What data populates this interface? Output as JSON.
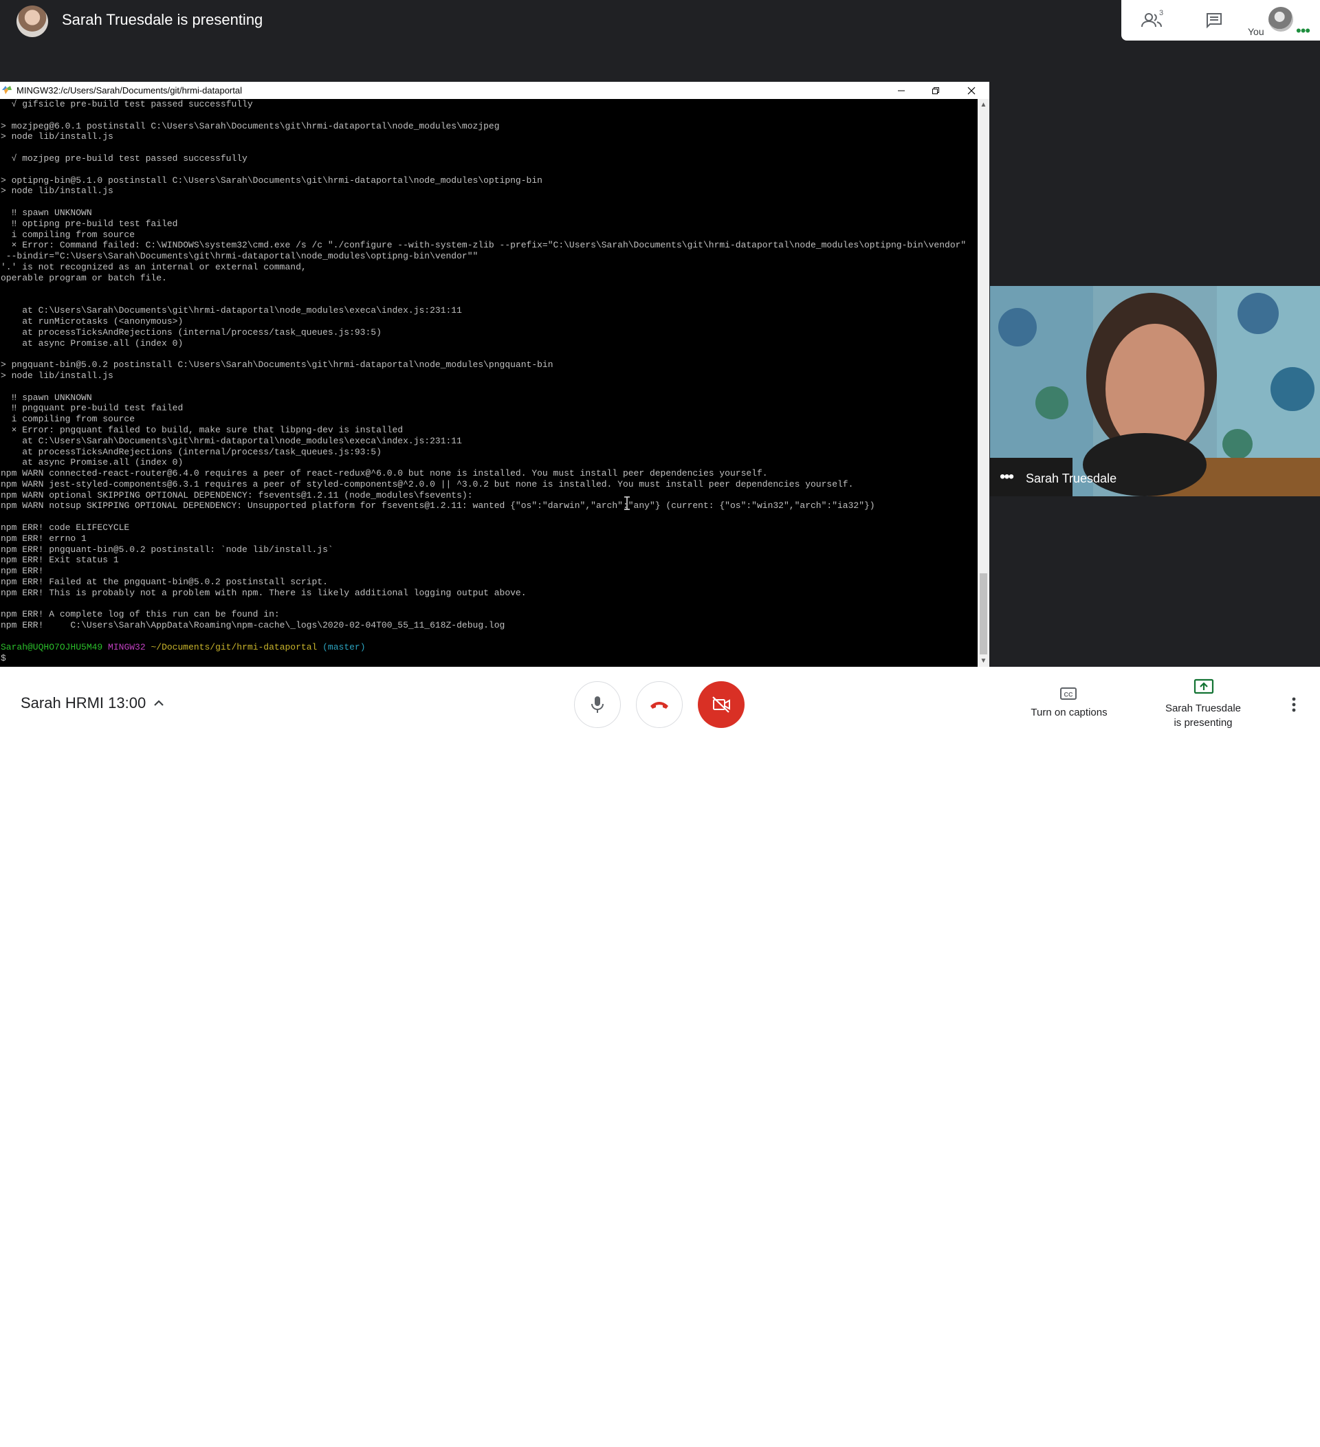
{
  "header": {
    "presenter_title": "Sarah Truesdale is presenting",
    "people_count": "3",
    "you_label": "You"
  },
  "terminal": {
    "window_title": "MINGW32:/c/Users/Sarah/Documents/git/hrmi-dataportal",
    "lines": [
      "  √ gifsicle pre-build test passed successfully",
      "",
      "> mozjpeg@6.0.1 postinstall C:\\Users\\Sarah\\Documents\\git\\hrmi-dataportal\\node_modules\\mozjpeg",
      "> node lib/install.js",
      "",
      "  √ mozjpeg pre-build test passed successfully",
      "",
      "> optipng-bin@5.1.0 postinstall C:\\Users\\Sarah\\Documents\\git\\hrmi-dataportal\\node_modules\\optipng-bin",
      "> node lib/install.js",
      "",
      "  ‼ spawn UNKNOWN",
      "  ‼ optipng pre-build test failed",
      "  i compiling from source",
      "  × Error: Command failed: C:\\WINDOWS\\system32\\cmd.exe /s /c \"./configure --with-system-zlib --prefix=\"C:\\Users\\Sarah\\Documents\\git\\hrmi-dataportal\\node_modules\\optipng-bin\\vendor\"",
      " --bindir=\"C:\\Users\\Sarah\\Documents\\git\\hrmi-dataportal\\node_modules\\optipng-bin\\vendor\"\"",
      "'.' is not recognized as an internal or external command,",
      "operable program or batch file.",
      "",
      "",
      "    at C:\\Users\\Sarah\\Documents\\git\\hrmi-dataportal\\node_modules\\execa\\index.js:231:11",
      "    at runMicrotasks (<anonymous>)",
      "    at processTicksAndRejections (internal/process/task_queues.js:93:5)",
      "    at async Promise.all (index 0)",
      "",
      "> pngquant-bin@5.0.2 postinstall C:\\Users\\Sarah\\Documents\\git\\hrmi-dataportal\\node_modules\\pngquant-bin",
      "> node lib/install.js",
      "",
      "  ‼ spawn UNKNOWN",
      "  ‼ pngquant pre-build test failed",
      "  i compiling from source",
      "  × Error: pngquant failed to build, make sure that libpng-dev is installed",
      "    at C:\\Users\\Sarah\\Documents\\git\\hrmi-dataportal\\node_modules\\execa\\index.js:231:11",
      "    at processTicksAndRejections (internal/process/task_queues.js:93:5)",
      "    at async Promise.all (index 0)",
      "npm WARN connected-react-router@6.4.0 requires a peer of react-redux@^6.0.0 but none is installed. You must install peer dependencies yourself.",
      "npm WARN jest-styled-components@6.3.1 requires a peer of styled-components@^2.0.0 || ^3.0.2 but none is installed. You must install peer dependencies yourself.",
      "npm WARN optional SKIPPING OPTIONAL DEPENDENCY: fsevents@1.2.11 (node_modules\\fsevents):",
      "npm WARN notsup SKIPPING OPTIONAL DEPENDENCY: Unsupported platform for fsevents@1.2.11: wanted {\"os\":\"darwin\",\"arch\":\"any\"} (current: {\"os\":\"win32\",\"arch\":\"ia32\"})",
      "",
      "npm ERR! code ELIFECYCLE",
      "npm ERR! errno 1",
      "npm ERR! pngquant-bin@5.0.2 postinstall: `node lib/install.js`",
      "npm ERR! Exit status 1",
      "npm ERR!",
      "npm ERR! Failed at the pngquant-bin@5.0.2 postinstall script.",
      "npm ERR! This is probably not a problem with npm. There is likely additional logging output above.",
      "",
      "npm ERR! A complete log of this run can be found in:",
      "npm ERR!     C:\\Users\\Sarah\\AppData\\Roaming\\npm-cache\\_logs\\2020-02-04T00_55_11_618Z-debug.log",
      ""
    ],
    "prompt_user": "Sarah@UQHO7OJHU5M49",
    "prompt_host": "MINGW32",
    "prompt_path": "~/Documents/git/hrmi-dataportal",
    "prompt_branch": "(master)",
    "prompt_symbol": "$"
  },
  "participant": {
    "name": "Sarah Truesdale"
  },
  "controls": {
    "meeting_title": "Sarah HRMI 13:00",
    "captions_label": "Turn on captions",
    "presenting_label_line1": "Sarah Truesdale",
    "presenting_label_line2": "is presenting"
  },
  "colors": {
    "stage_bg": "#202124",
    "hangup_red": "#d93025",
    "present_teal": "#137333",
    "participant_dots": "#1e8e3e"
  }
}
